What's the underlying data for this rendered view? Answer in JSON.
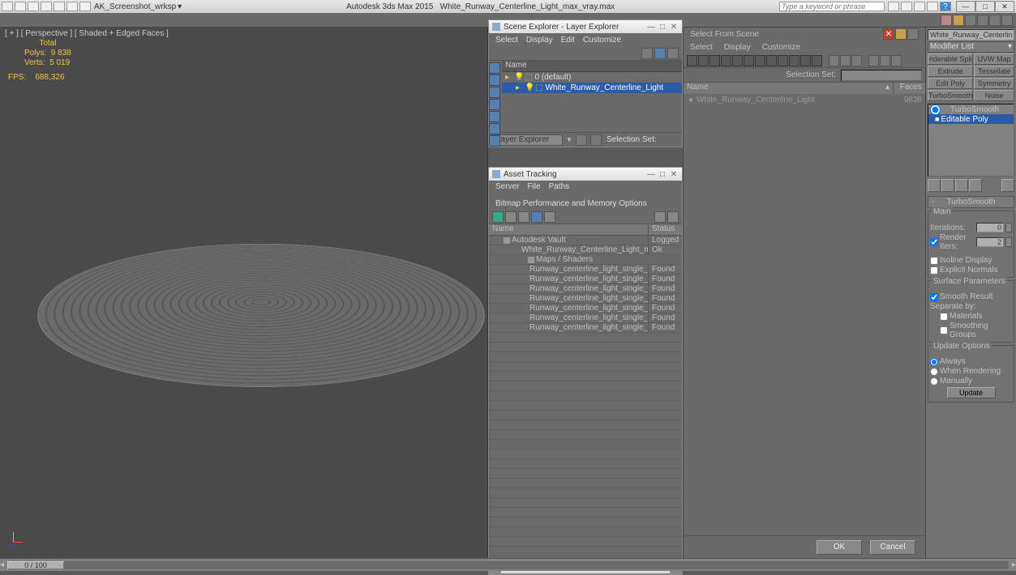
{
  "titlebar": {
    "workspace": "AK_Screenshot_wrksp",
    "app": "Autodesk 3ds Max 2015",
    "file": "White_Runway_Centerline_Light_max_vray.max",
    "search_placeholder": "Type a keyword or phrase"
  },
  "viewport": {
    "label": "[ + ] [ Perspective ] [ Shaded + Edged Faces ]",
    "stats_header": "Total",
    "polys_label": "Polys:",
    "polys_value": "9 838",
    "verts_label": "Verts:",
    "verts_value": "5 019",
    "fps_label": "FPS:",
    "fps_value": "688,326"
  },
  "scene_explorer": {
    "title": "Scene Explorer - Layer Explorer",
    "menu": {
      "select": "Select",
      "display": "Display",
      "edit": "Edit",
      "customize": "Customize"
    },
    "col_name": "Name",
    "rows": [
      {
        "label": "0 (default)"
      },
      {
        "label": "White_Runway_Centerline_Light"
      }
    ],
    "bottom_combo": "Layer Explorer",
    "bottom_sel": "Selection Set:"
  },
  "asset_tracking": {
    "title": "Asset Tracking",
    "menu": {
      "server": "Server",
      "file": "File",
      "paths": "Paths",
      "bitmap": "Bitmap Performance and Memory Options"
    },
    "col_name": "Name",
    "col_status": "Status",
    "rows": [
      {
        "name": "Autodesk Vault",
        "status": "Logged",
        "indent": 1
      },
      {
        "name": "White_Runway_Centerline_Light_max_vray.max",
        "status": "Ok",
        "indent": 2
      },
      {
        "name": "Maps / Shaders",
        "status": "",
        "indent": 3
      },
      {
        "name": "Runway_centerline_light_single_Diffuse.png",
        "status": "Found",
        "indent": 3
      },
      {
        "name": "Runway_centerline_light_single_Emissive....",
        "status": "Found",
        "indent": 3
      },
      {
        "name": "Runway_centerline_light_single_Fresnel.png",
        "status": "Found",
        "indent": 3
      },
      {
        "name": "Runway_centerline_light_single_Glossines...",
        "status": "Found",
        "indent": 3
      },
      {
        "name": "Runway_centerline_light_single_Normal.p...",
        "status": "Found",
        "indent": 3
      },
      {
        "name": "Runway_centerline_light_single_Refractio...",
        "status": "Found",
        "indent": 3
      },
      {
        "name": "Runway_centerline_light_single_Specular....",
        "status": "Found",
        "indent": 3
      }
    ]
  },
  "select_from_scene": {
    "title": "Select From Scene",
    "menu": {
      "select": "Select",
      "display": "Display",
      "customize": "Customize"
    },
    "sel_set": "Selection Set:",
    "col_name": "Name",
    "col_faces": "Faces",
    "rows": [
      {
        "name": "White_Runway_Centerline_Light",
        "faces": "9838"
      }
    ],
    "ok": "OK",
    "cancel": "Cancel"
  },
  "modifier_panel": {
    "obj_name": "White_Runway_Centerline_Li",
    "modlist": "Modifier List",
    "buttons": {
      "renderable_spl": "nderable Spli",
      "uvw_map": "UVW Map",
      "extrude": "Extrude",
      "tessellate": "Tessellate",
      "edit_poly": "Edit Poly",
      "symmetry": "Symmetry",
      "turbosmooth": "TurboSmooth",
      "noise": "Noise"
    },
    "stack": {
      "item1": "TurboSmooth",
      "item2": "Editable Poly"
    },
    "rollout_title": "TurboSmooth",
    "main": {
      "title": "Main",
      "iterations": "Iterations:",
      "iterations_val": "0",
      "render_iters": "Render Iters:",
      "render_iters_val": "2",
      "isoline": "Isoline Display",
      "explicit": "Explicit Normals"
    },
    "surface": {
      "title": "Surface Parameters",
      "smooth_result": "Smooth Result",
      "separate": "Separate by:",
      "materials": "Materials",
      "smoothing_groups": "Smoothing Groups"
    },
    "update": {
      "title": "Update Options",
      "always": "Always",
      "when_rendering": "When Rendering",
      "manually": "Manually",
      "update_btn": "Update"
    }
  },
  "timeline": {
    "handle": "0 / 100"
  }
}
